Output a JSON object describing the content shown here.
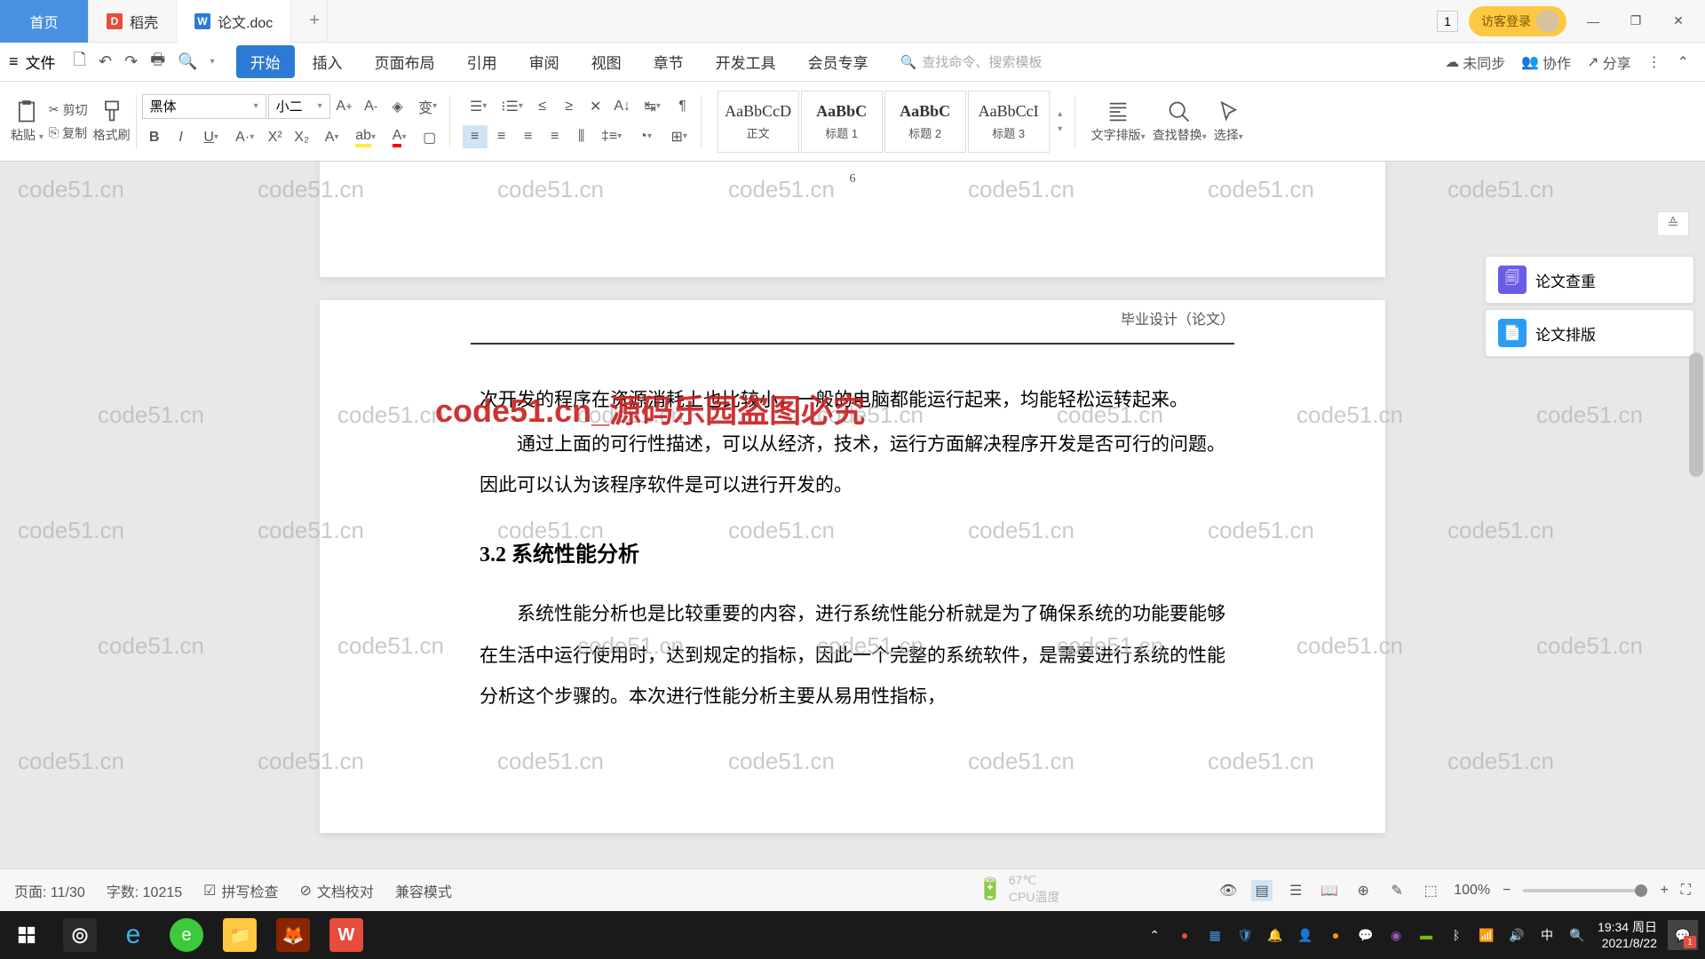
{
  "tabs": {
    "home": "首页",
    "docao": "稻壳",
    "doc": "论文.doc"
  },
  "titlebar": {
    "num": "1",
    "guest": "访客登录"
  },
  "menu": {
    "file": "文件",
    "items": [
      "开始",
      "插入",
      "页面布局",
      "引用",
      "审阅",
      "视图",
      "章节",
      "开发工具",
      "会员专享"
    ],
    "search_ph": "查找命令、搜索模板",
    "unsync": "未同步",
    "collab": "协作",
    "share": "分享"
  },
  "ribbon": {
    "paste": "粘贴",
    "cut": "剪切",
    "copy": "复制",
    "fmt_painter": "格式刷",
    "font": "黑体",
    "size": "小二",
    "text_layout": "文字排版",
    "find_replace": "查找替换",
    "select": "选择",
    "styles": [
      {
        "preview": "AaBbCcD",
        "name": "正文"
      },
      {
        "preview": "AaBbC",
        "name": "标题 1"
      },
      {
        "preview": "AaBbC",
        "name": "标题 2"
      },
      {
        "preview": "AaBbCcI",
        "name": "标题 3"
      }
    ]
  },
  "side": {
    "check": "论文查重",
    "layout": "论文排版"
  },
  "doc": {
    "page_num": "6",
    "header": "毕业设计（论文）",
    "p1": "次开发的程序在资源消耗上也比较小，一般的电脑都能运行起来，均能轻松运转起来。",
    "p2": "通过上面的可行性描述，可以从经济，技术，运行方面解决程序开发是否可行的问题。因此可以认为该程序软件是可以进行开发的。",
    "sec": "3.2  系统性能分析",
    "p3": "系统性能分析也是比较重要的内容，进行系统性能分析就是为了确保系统的功能要能够在生活中运行使用时，达到规定的指标，因此一个完整的系统软件，是需要进行系统的性能分析这个步骤的。本次进行性能分析主要从易用性指标，"
  },
  "watermark": {
    "main": "code51.cn_源码乐园盗图必究",
    "bg": "code51.cn",
    "cpu": "CPU温度"
  },
  "status": {
    "page": "页面: 11/30",
    "words": "字数: 10215",
    "spell": "拼写检查",
    "proof": "文档校对",
    "compat": "兼容模式",
    "zoom": "100%"
  },
  "taskbar": {
    "temp": "67℃",
    "time": "19:34 周日",
    "date": "2021/8/22",
    "notif": "1",
    "ime": "中"
  }
}
